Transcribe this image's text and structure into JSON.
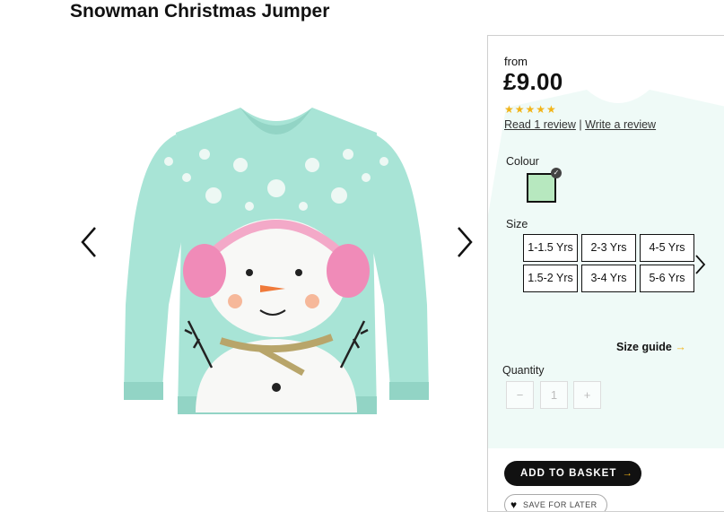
{
  "product": {
    "title": "Snowman Christmas Jumper",
    "price_prefix": "from",
    "price": "£9.00",
    "rating": 5,
    "stars_text": "★★★★★",
    "read_reviews": "Read 1 review",
    "separator": "|",
    "write_review": "Write a review"
  },
  "colour": {
    "label": "Colour",
    "selected_hex": "#b7e8bf"
  },
  "size": {
    "label": "Size",
    "options": [
      "1-1.5 Yrs",
      "2-3 Yrs",
      "4-5 Yrs",
      "1.5-2 Yrs",
      "3-4 Yrs",
      "5-6 Yrs"
    ],
    "guide_label": "Size guide",
    "guide_arrow": "→"
  },
  "quantity": {
    "label": "Quantity",
    "minus": "−",
    "value": "1",
    "plus": "+"
  },
  "actions": {
    "add_to_basket": "ADD TO BASKET",
    "add_arrow": "→",
    "save_for_later": "SAVE FOR LATER"
  },
  "colors": {
    "jumper": "#a8e4d6",
    "star": "#f2b418"
  },
  "icons": {
    "prev": "chevron-left-icon",
    "next": "chevron-right-icon",
    "heart": "heart-icon",
    "check": "checkmark-icon"
  }
}
